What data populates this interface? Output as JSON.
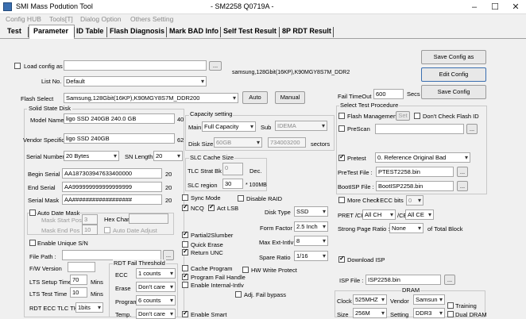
{
  "window": {
    "title": "SMI Mass Podution Tool",
    "subtitle": "- SM2258 Q0719A -"
  },
  "menu": [
    "Config HUB",
    "Tools[T]",
    "Dialog Option",
    "Others Setting"
  ],
  "tabs": [
    "Test",
    "Parameter",
    "ID Table",
    "Flash Diagnosis",
    "Mark BAD Info",
    "Self Test Result",
    "8P RDT Result"
  ],
  "config": {
    "load_label": "Load config as",
    "browse": "...",
    "list_no_label": "List No.",
    "list_no": "Default",
    "flash_desc": "samsung,128Gbit(16KP),K90MGY8S7M_DDR2",
    "flash_select_label": "Flash Select",
    "flash_select": "Samsung,128Gbit(16KP),K90MGY8S7M_DDR200",
    "auto": "Auto",
    "manual": "Manual"
  },
  "buttons": {
    "save_config_as": "Save Config as",
    "edit_config": "Edit Config",
    "save_config": "Save Config"
  },
  "ssd": {
    "group": "Solid State Disk",
    "model_label": "Model Name",
    "model": "ligo SSD 240GB 240.0 GB",
    "model_len": "40",
    "vendor_label": "Vendor Specific",
    "vendor": "ligo SSD 240GB",
    "vendor_len": "62",
    "serial_label": "Serial Number",
    "serial": "20 Bytes",
    "sn_len_label": "SN Length",
    "sn_len": "20",
    "begin_label": "Begin Serial",
    "begin": "AA187303947633400000",
    "begin_len": "20",
    "end_label": "End Serial",
    "end": "AA999999999999999999",
    "end_len": "20",
    "mask_label": "Serial Mask",
    "mask": "AA##################",
    "mask_len": "20",
    "auto_mask": "Auto Date Mask",
    "mask_start": "Mask Start Pos",
    "mask_start_val": "3",
    "hex_char": "Hex Char:",
    "mask_end": "Mask End Pos",
    "mask_end_val": "10",
    "auto_date_adjust": "Auto Date Adjust",
    "unique_sn": "Enable Unique S/N",
    "file_path": "File Path :",
    "fw_version": "F/W Version",
    "lts_setup": "LTS Setup Time",
    "lts_setup_val": "70",
    "lts_test": "LTS Test Time",
    "lts_test_val": "10",
    "mins": "Mins",
    "rdt_ecc": "RDT ECC TLC TH",
    "rdt_ecc_val": "1bits"
  },
  "capacity": {
    "group": "Capacity setting",
    "main_label": "Main",
    "main": "Full Capacity",
    "sub_label": "Sub",
    "sub": "IDEMA",
    "disk_size_label": "Disk Size",
    "disk_size": "60GB",
    "sectors_val": "734003200",
    "sectors": "sectors"
  },
  "slc": {
    "group": "SLC Cache Size",
    "tlc_strat": "TLC Strat Bk",
    "tlc_strat_val": "0",
    "dec": "Dec.",
    "slc_region": "SLC region",
    "slc_region_val": "30",
    "unit": "* 100MB"
  },
  "opts": {
    "sync_mode": "Sync Mode",
    "disable_raid": "Disable RAID",
    "ncq": "NCQ",
    "act_lsb": "Act LSB",
    "disk_type": "Disk Type",
    "disk_type_val": "SSD",
    "form_factor": "Form Factor",
    "form_factor_val": "2.5 Inch",
    "max_ext": "Max Ext-Intlv",
    "max_ext_val": "8",
    "spare_ratio": "Spare Ratio",
    "spare_ratio_val": "1/16",
    "partial": "Partial2Slumber",
    "quick_erase": "Quick Erase",
    "return_unc": "Return UNC",
    "cache_program": "Cache Program",
    "hw_write_protect": "HW Write Protect",
    "program_fail": "Program Fail Handle",
    "internal_intlv": "Enable Internal-Intlv",
    "adj_fail": "Adj. Fail bypass",
    "smart": "Enable Smart"
  },
  "rdt": {
    "group": "RDT Fail Threshold",
    "ecc": "ECC",
    "ecc_val": "1 counts",
    "erase": "Erase",
    "erase_val": "Don't care",
    "program": "Program",
    "program_val": "6 counts",
    "temp": "Temp.",
    "temp_val": "Don't care"
  },
  "right": {
    "fail_timeout": "Fail TimeOut",
    "fail_timeout_val": "600",
    "secs": "Secs",
    "procedure": "Select Test Procedure",
    "flash_mgmt": "Flash Management",
    "set": "Set",
    "no_check_id": "Don't Check Flash ID",
    "prescan": "PreScan",
    "pretest": "Pretest",
    "pretest_val": "0. Reference Original Bad",
    "pretest_file": "PreTest File :",
    "pretest_file_val": "PTEST2258.bin",
    "bootisp_file": "BootISP File :",
    "bootisp_file_val": "BootISP2258.bin",
    "more_check": "More Check",
    "ecc_bits": "/ ECC bits",
    "ecc_bits_val": "0",
    "pret_ch": "PRET /CH",
    "pret_ch_val": "All CH",
    "ce": "/CE",
    "ce_val": "All CE",
    "strong": "Strong Page Ratio :",
    "strong_val": "None",
    "total_block": "of Total Block",
    "download_isp": "Download ISP",
    "isp_file": "ISP File :",
    "isp_file_val": "ISP2258.bin",
    "dram": "DRAM",
    "clock": "Clock",
    "clock_val": "525MHZ",
    "vendor": "Vendor",
    "vendor_val": "Samsun",
    "training": "Training",
    "size": "Size",
    "size_val": "256M",
    "setting": "Setting",
    "setting_val": "DDR3",
    "dual_dram": "Dual DRAM"
  }
}
